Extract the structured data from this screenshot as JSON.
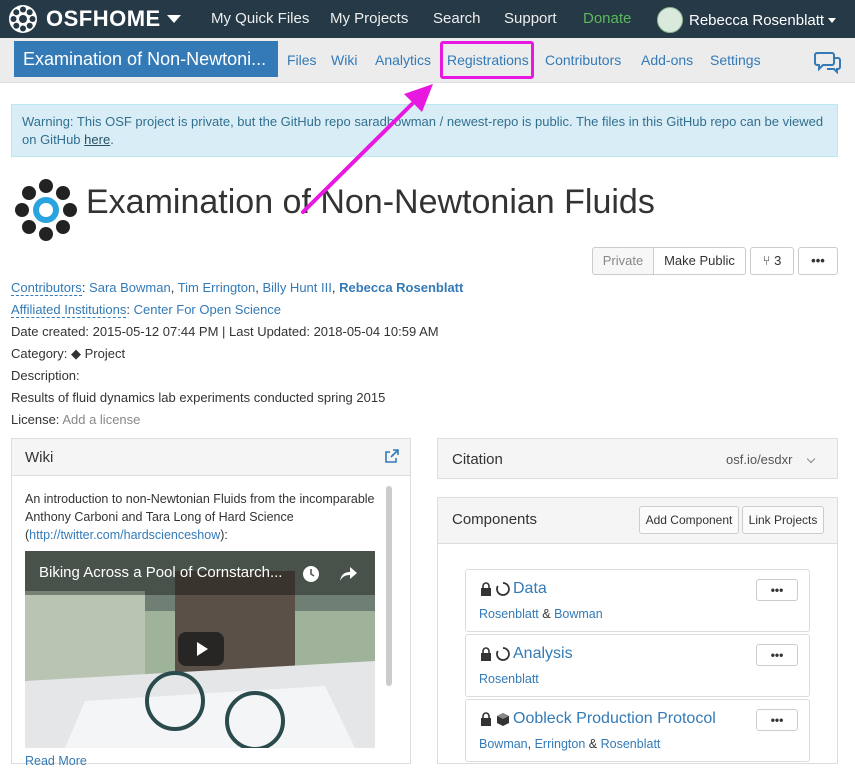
{
  "topnav": {
    "brand": "OSFHOME",
    "links": [
      "My Quick Files",
      "My Projects",
      "Search",
      "Support",
      "Donate"
    ],
    "user_name": "Rebecca Rosenblatt"
  },
  "projnav": {
    "title": "Examination of Non-Newtoni...",
    "tabs": [
      "Files",
      "Wiki",
      "Analytics",
      "Registrations",
      "Contributors",
      "Add-ons",
      "Settings"
    ]
  },
  "alert": {
    "text": "Warning: This OSF project is private, but the GitHub repo saradbowman / newest-repo is public. The files in this GitHub repo can be viewed on GitHub ",
    "link": "here",
    "end": "."
  },
  "project": {
    "title": "Examination of Non-Newtonian Fluids",
    "buttons": {
      "private": "Private",
      "make_public": "Make Public",
      "forks": "3",
      "more": "•••"
    },
    "contributors_label": "Contributors",
    "contributors": [
      "Sara Bowman",
      "Tim Errington",
      "Billy Hunt III",
      "Rebecca Rosenblatt"
    ],
    "institutions_label": "Affiliated Institutions",
    "institution": "Center For Open Science",
    "dates": "Date created: 2015-05-12 07:44 PM | Last Updated: 2018-05-04 10:59 AM",
    "category_label": "Category:",
    "category": "Project",
    "description_label": "Description:",
    "description": "Results of fluid dynamics lab experiments conducted spring 2015",
    "license_label": "License:",
    "license": "Add a license"
  },
  "wiki": {
    "title": "Wiki",
    "text": "An introduction to non-Newtonian Fluids from the incomparable Anthony Carboni and Tara Long of Hard Science (",
    "link": "http://twitter.com/hardscienceshow",
    "text_end": "):",
    "video_title": "Biking Across a Pool of Cornstarch...",
    "read_more": "Read More"
  },
  "citation": {
    "title": "Citation",
    "link": "osf.io/esdxr"
  },
  "components": {
    "title": "Components",
    "add_button": "Add Component",
    "link_button": "Link Projects",
    "items": [
      {
        "title": "Data",
        "contributors": [
          "Rosenblatt",
          "Bowman"
        ],
        "more": "•••"
      },
      {
        "title": "Analysis",
        "contributors": [
          "Rosenblatt"
        ],
        "more": "•••"
      },
      {
        "title": "Oobleck Production Protocol",
        "contributors": [
          "Bowman",
          "Errington",
          "Rosenblatt"
        ],
        "more": "•••"
      }
    ]
  },
  "colors": {
    "navbar": "#263947",
    "project_title_bg": "#337ab7",
    "highlight": "#e818e0",
    "link": "#337ab7",
    "donate": "#5cb85c"
  }
}
